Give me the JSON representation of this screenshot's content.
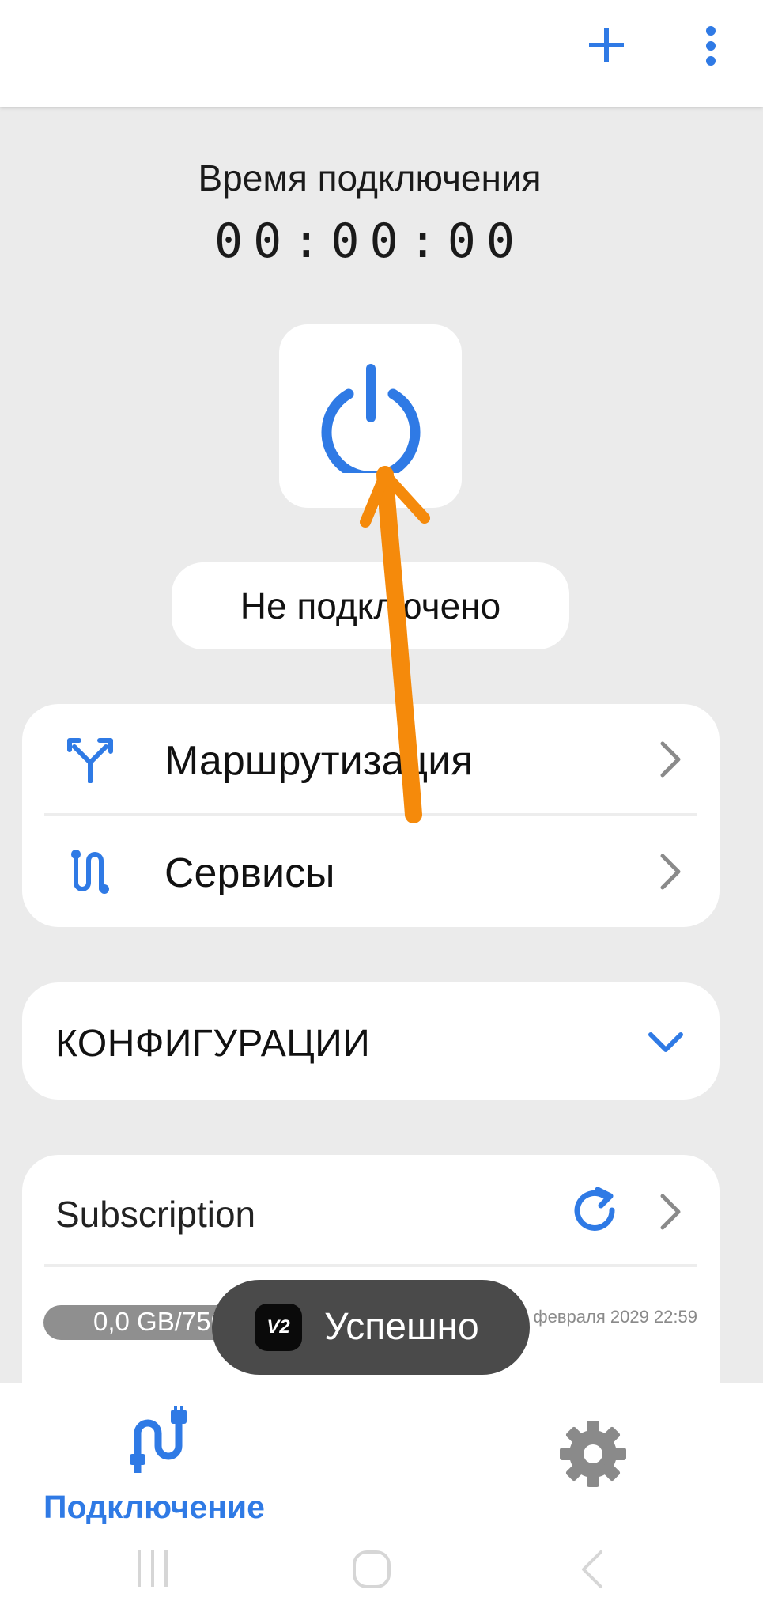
{
  "colors": {
    "accent": "#2f7ae5",
    "annotation": "#f58a0b",
    "background": "#ebebeb"
  },
  "top_bar": {
    "add_icon": "plus-icon",
    "menu_icon": "more-vertical-icon"
  },
  "timer": {
    "title": "Время подключения",
    "value": "00:00:00"
  },
  "power_button": {
    "icon": "power-icon"
  },
  "status": {
    "text": "Не подключено"
  },
  "menu": {
    "items": [
      {
        "label": "Маршрутизация",
        "icon": "routing-icon"
      },
      {
        "label": "Сервисы",
        "icon": "services-icon"
      }
    ]
  },
  "configs": {
    "label": "КОНФИГУРАЦИИ",
    "icon": "chevron-down-icon"
  },
  "subscription": {
    "label": "Subscription",
    "usage": "0,0 GB/750,0 GB",
    "active_until": "Активно до: 24 февраля 2029 22:59"
  },
  "toast": {
    "badge": "V2",
    "message": "Успешно"
  },
  "bottom_nav": {
    "connection_label": "Подключение",
    "settings_icon": "gear-icon"
  }
}
